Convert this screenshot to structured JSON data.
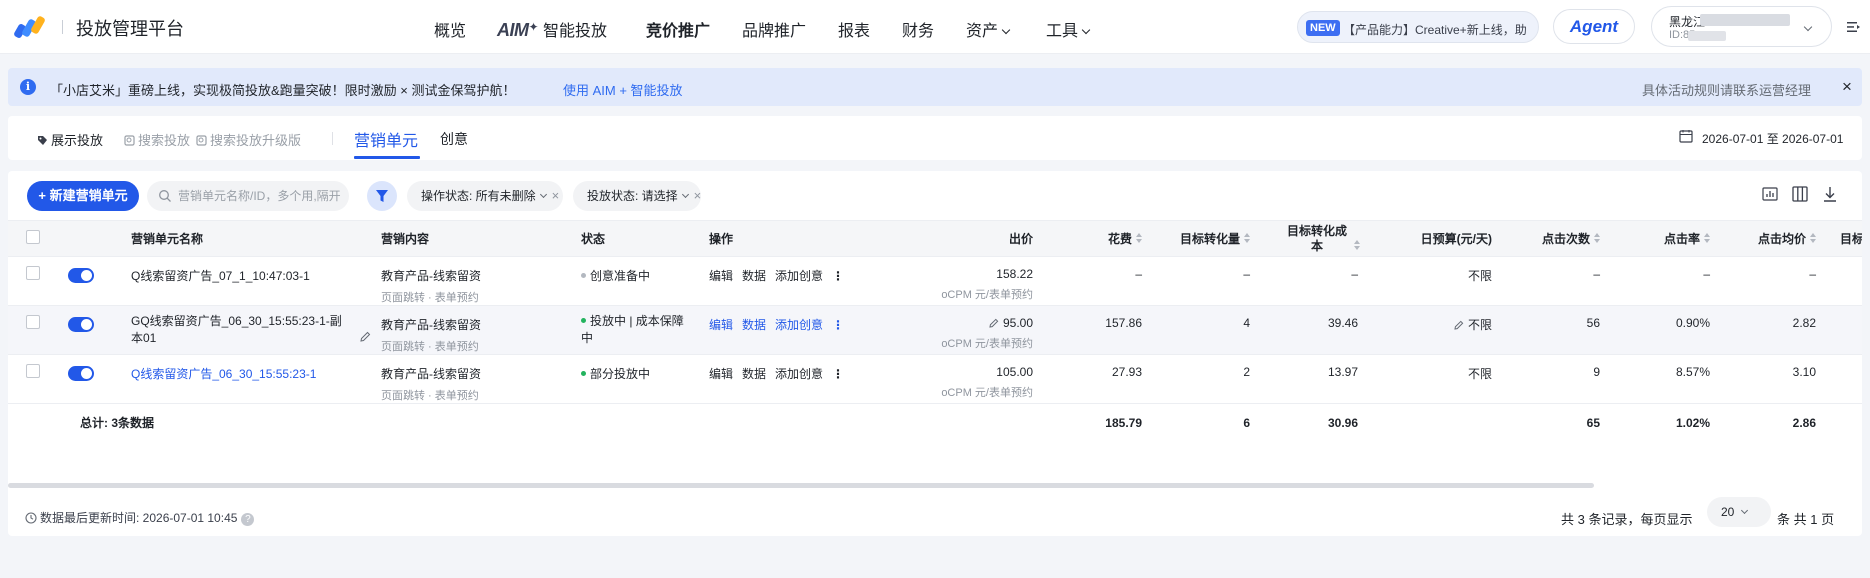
{
  "header": {
    "brand": "投放管理平台",
    "nav": [
      {
        "label": "概览"
      },
      {
        "label": "AIM",
        "suffix": "智能投放"
      },
      {
        "label": "竞价推广"
      },
      {
        "label": "品牌推广"
      },
      {
        "label": "报表"
      },
      {
        "label": "财务"
      },
      {
        "label": "资产"
      },
      {
        "label": "工具"
      }
    ],
    "announcement_tag": "NEW",
    "announcement": "【产品能力】Creative+新上线，助",
    "agent_label": "Agent",
    "account_name": "黑龙江",
    "account_id": "ID:85"
  },
  "notice": {
    "text": "「小店艾米」重磅上线，实现极简投放&跑量突破！限时激励 × 测试金保驾护航！",
    "link": "使用 AIM + 智能投放",
    "right": "具体活动规则请联系运营经理",
    "close": "×"
  },
  "tabs": {
    "channels": [
      {
        "label": "展示投放"
      },
      {
        "label": "搜索投放"
      },
      {
        "label": "搜索投放升级版"
      }
    ],
    "main_tabs": [
      {
        "label": "营销单元"
      },
      {
        "label": "创意"
      }
    ],
    "date_range": "2026-07-01 至 2026-07-01"
  },
  "toolbar": {
    "new_button": "+ 新建营销单元",
    "search_placeholder": "营销单元名称/ID，多个用,隔开",
    "filters": [
      {
        "label": "操作状态: 所有未删除"
      },
      {
        "label": "投放状态: 请选择"
      }
    ]
  },
  "table": {
    "headers": {
      "name": "营销单元名称",
      "content": "营销内容",
      "status": "状态",
      "ops": "操作",
      "bid": "出价",
      "spend": "花费",
      "conv": "目标转化量",
      "conv_cost": "目标转化成本",
      "budget": "日预算(元/天)",
      "clicks": "点击次数",
      "ctr": "点击率",
      "cpc": "点击均价",
      "more": "目标"
    },
    "op_labels": {
      "edit": "编辑",
      "data": "数据",
      "add": "添加创意",
      "more": "⋮"
    },
    "rows": [
      {
        "name": "Q线索留资广告_07_1_10:47:03-1",
        "content": "教育产品-线索留资",
        "content_sub": "页面跳转 · 表单预约",
        "status": "创意准备中",
        "bid": "158.22",
        "bid_unit": "oCPM 元/表单预约",
        "spend": "–",
        "conv": "–",
        "conv_cost": "–",
        "budget": "不限",
        "clicks": "–",
        "ctr": "–",
        "cpc": "–"
      },
      {
        "name": "GQ线索留资广告_06_30_15:55:23-1-副本01",
        "content": "教育产品-线索留资",
        "content_sub": "页面跳转 · 表单预约",
        "status": "投放中 | 成本保障中",
        "bid": "95.00",
        "bid_unit": "oCPM 元/表单预约",
        "spend": "157.86",
        "conv": "4",
        "conv_cost": "39.46",
        "budget": "不限",
        "clicks": "56",
        "ctr": "0.90%",
        "cpc": "2.82"
      },
      {
        "name": "Q线索留资广告_06_30_15:55:23-1",
        "content": "教育产品-线索留资",
        "content_sub": "页面跳转 · 表单预约",
        "status": "部分投放中",
        "bid": "105.00",
        "bid_unit": "oCPM 元/表单预约",
        "spend": "27.93",
        "conv": "2",
        "conv_cost": "13.97",
        "budget": "不限",
        "clicks": "9",
        "ctr": "8.57%",
        "cpc": "3.10"
      }
    ],
    "total": {
      "label": "总计: 3条数据",
      "spend": "185.79",
      "conv": "6",
      "conv_cost": "30.96",
      "clicks": "65",
      "ctr": "1.02%",
      "cpc": "2.86"
    }
  },
  "footer": {
    "update_label": "数据最后更新时间: 2026-07-01 10:45",
    "pager_left": "共 3 条记录，每页显示",
    "page_size": "20",
    "pager_right": "条 共 1 页"
  },
  "colors": {
    "primary": "#2258e8",
    "status_preparing": "#b3b8c0",
    "status_running": "#23b35e"
  }
}
